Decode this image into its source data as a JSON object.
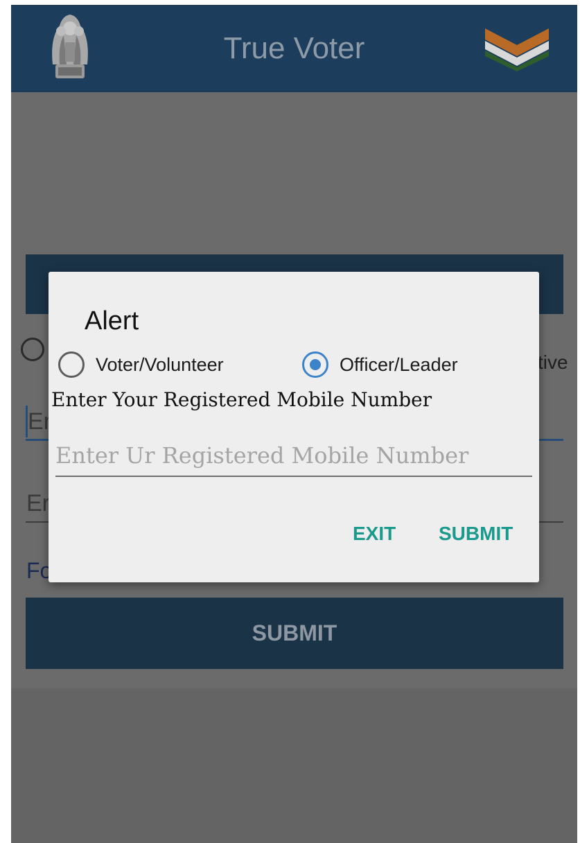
{
  "app_bar": {
    "title": "True Voter",
    "emblem_icon": "national-emblem-icon",
    "flag_icon": "tricolor-chevron-icon",
    "background_color": "#1c3e5c"
  },
  "background_form": {
    "radio_partial_text": "tive",
    "field1_partial": "Er",
    "field2_partial": "Er",
    "link_partial": "Fo",
    "submit_label": "SUBMIT"
  },
  "dialog": {
    "title": "Alert",
    "options": [
      {
        "label": "Voter/Volunteer",
        "selected": false
      },
      {
        "label": "Officer/Leader",
        "selected": true
      }
    ],
    "field_label": "Enter Your Registered Mobile Number",
    "input_placeholder": "Enter Ur Registered Mobile Number",
    "input_value": "",
    "exit_label": "EXIT",
    "submit_label": "SUBMIT",
    "accent_color": "#1a9a8c",
    "radio_color": "#3d83c9"
  }
}
